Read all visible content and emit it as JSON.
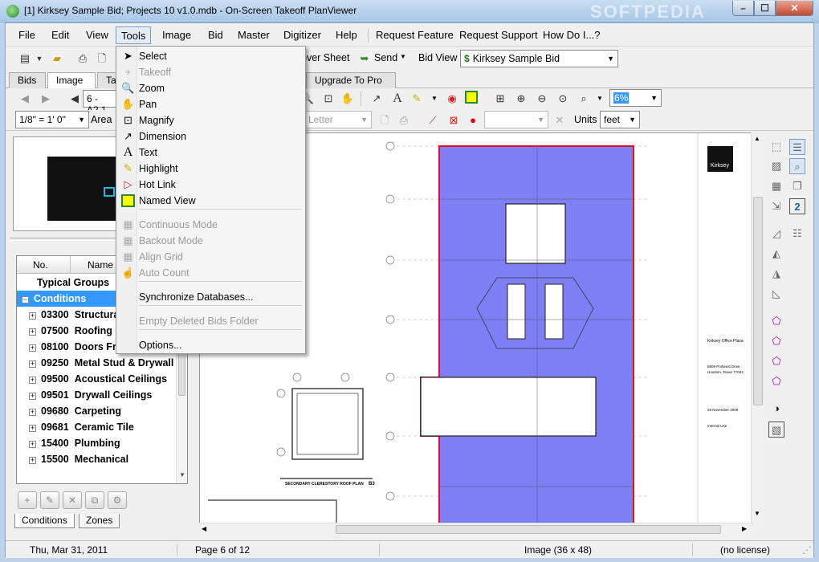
{
  "window": {
    "title": "[1] Kirksey Sample Bid; Projects 10 v1.0.mdb - On-Screen Takeoff PlanViewer",
    "watermark": "SOFTPEDIA"
  },
  "menubar": {
    "items": [
      "File",
      "Edit",
      "View",
      "Tools",
      "Image",
      "Bid",
      "Master",
      "Digitizer",
      "Help",
      "Request Feature",
      "Request Support",
      "How Do I...?"
    ],
    "active": "Tools"
  },
  "toolbar1": {
    "cover_sheet_label": "over Sheet",
    "send_label": "Send",
    "bid_view_label": "Bid View",
    "bid_select": "Kirksey Sample Bid"
  },
  "tabs": {
    "bids": "Bids",
    "image": "Image",
    "takeoff_partial": "Ta",
    "upgrade": "Upgrade To Pro"
  },
  "toolbar2": {
    "page_select": "6 - A2.1",
    "zoom_value": "6%"
  },
  "toolbar3": {
    "scale_select": "1/8\" = 1' 0\"",
    "area_label": "Area",
    "paper_select": "Letter",
    "units_label": "Units",
    "units_select": "feet"
  },
  "tree": {
    "col_no": "No.",
    "col_name": "Name",
    "typical_groups": "Typical Groups",
    "conditions": "Conditions",
    "items": [
      {
        "no": "03300",
        "name": "Structural"
      },
      {
        "no": "07500",
        "name": "Roofing"
      },
      {
        "no": "08100",
        "name": "Doors Fr"
      },
      {
        "no": "09250",
        "name": "Metal Stud & Drywall"
      },
      {
        "no": "09500",
        "name": "Acoustical Ceilings"
      },
      {
        "no": "09501",
        "name": "Drywall Ceilings"
      },
      {
        "no": "09680",
        "name": "Carpeting"
      },
      {
        "no": "09681",
        "name": "Ceramic Tile"
      },
      {
        "no": "15400",
        "name": "Plumbing"
      },
      {
        "no": "15500",
        "name": "Mechanical"
      }
    ]
  },
  "bottom_tabs": {
    "conditions": "Conditions",
    "zones": "Zones"
  },
  "drawing": {
    "firm_logo": "Kirksey",
    "plan_caption": "SECONDARY CLERESTORY ROOF PLAN",
    "plan_caption_id": "B3",
    "project_name": "Kirksey Office Plaza",
    "address_line1": "6909 Portwest Drive",
    "address_line2": "Houston, Texas 77024",
    "issue_date": "28 November 2008",
    "issue_purpose": "Internal Use"
  },
  "tools_menu": {
    "items": [
      {
        "label": "Select",
        "icon": "arrow-cursor-icon",
        "glyph": "➤",
        "enabled": true
      },
      {
        "label": "Takeoff",
        "icon": "crosshair-icon",
        "glyph": "+",
        "enabled": false
      },
      {
        "label": "Zoom",
        "icon": "magnifier-icon",
        "glyph": "🔍",
        "enabled": true
      },
      {
        "label": "Pan",
        "icon": "hand-icon",
        "glyph": "✋",
        "enabled": true
      },
      {
        "label": "Magnify",
        "icon": "magnify-box-icon",
        "glyph": "⊡",
        "enabled": true
      },
      {
        "label": "Dimension",
        "icon": "dimension-icon",
        "glyph": "↗",
        "enabled": true
      },
      {
        "label": "Text",
        "icon": "text-a-icon",
        "glyph": "A",
        "enabled": true
      },
      {
        "label": "Highlight",
        "icon": "highlighter-icon",
        "glyph": "✎",
        "enabled": true
      },
      {
        "label": "Hot Link",
        "icon": "hotlink-icon",
        "glyph": "▷",
        "enabled": true
      },
      {
        "label": "Named View",
        "icon": "named-view-icon",
        "glyph": "■",
        "enabled": true
      },
      {
        "label": "Continuous Mode",
        "icon": "continuous-mode-icon",
        "glyph": "▦",
        "enabled": false
      },
      {
        "label": "Backout Mode",
        "icon": "backout-mode-icon",
        "glyph": "▦",
        "enabled": false
      },
      {
        "label": "Align Grid",
        "icon": "align-grid-icon",
        "glyph": "▦",
        "enabled": false
      },
      {
        "label": "Auto Count",
        "icon": "auto-count-icon",
        "glyph": "☝",
        "enabled": false
      },
      {
        "label": "Synchronize Databases...",
        "icon": "",
        "glyph": "",
        "enabled": true
      },
      {
        "label": "Empty Deleted Bids Folder",
        "icon": "",
        "glyph": "",
        "enabled": false
      },
      {
        "label": "Options...",
        "icon": "",
        "glyph": "",
        "enabled": true
      }
    ]
  },
  "statusbar": {
    "date": "Thu, Mar 31, 2011",
    "page": "Page 6 of 12",
    "image_size": "Image (36 x 48)",
    "license": "(no license)"
  },
  "colors": {
    "highlight_fill": "#7f7ff5",
    "outline_red": "#e0101c",
    "selection_blue": "#3399ff"
  }
}
